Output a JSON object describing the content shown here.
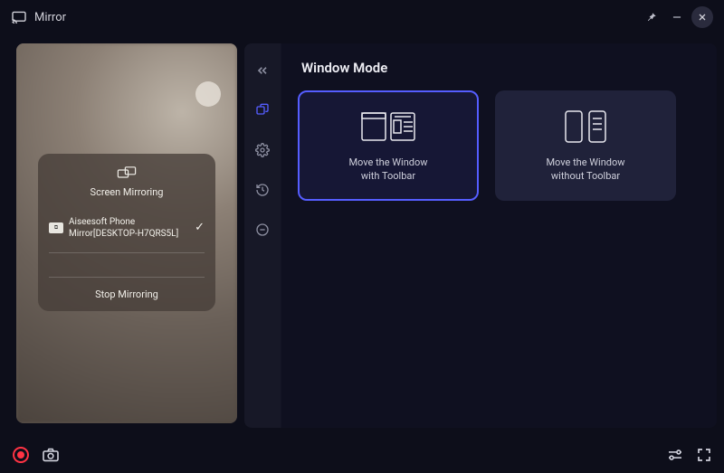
{
  "titlebar": {
    "app_name": "Mirror"
  },
  "preview": {
    "dialog_title": "Screen Mirroring",
    "device_name": "Aiseesoft Phone Mirror[DESKTOP-H7QRS5L]",
    "stop_label": "Stop Mirroring"
  },
  "config": {
    "section_title": "Window Mode",
    "card1_line1": "Move the Window",
    "card1_line2": "with Toolbar",
    "card2_line1": "Move the Window",
    "card2_line2": "without Toolbar"
  }
}
